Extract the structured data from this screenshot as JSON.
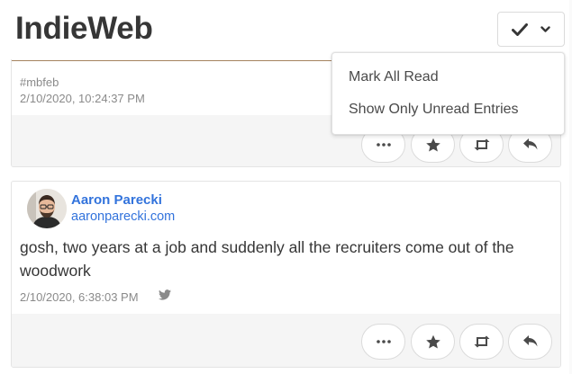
{
  "header": {
    "title": "IndieWeb",
    "mark_read_button": {
      "icons": [
        "check-icon",
        "chevron-down-icon"
      ]
    }
  },
  "dropdown": {
    "items": [
      {
        "label": "Mark All Read"
      },
      {
        "label": "Show Only Unread Entries"
      }
    ]
  },
  "posts": [
    {
      "hashtag": "#mbfeb",
      "timestamp": "2/10/2020, 10:24:37 PM",
      "actions": [
        "more-icon",
        "star-icon",
        "repost-icon",
        "reply-icon"
      ]
    },
    {
      "author": {
        "name": "Aaron Parecki",
        "url": "aaronparecki.com"
      },
      "content": "gosh, two years at a job and suddenly all the recruiters come out of the woodwork",
      "timestamp": "2/10/2020, 6:38:03 PM",
      "source_icon": "twitter-icon",
      "actions": [
        "more-icon",
        "star-icon",
        "repost-icon",
        "reply-icon"
      ]
    }
  ],
  "colors": {
    "link": "#3273dc",
    "text": "#363636",
    "muted": "#8a8a8a",
    "footer_bg": "#f5f5f5",
    "border": "#dbdbdb"
  }
}
